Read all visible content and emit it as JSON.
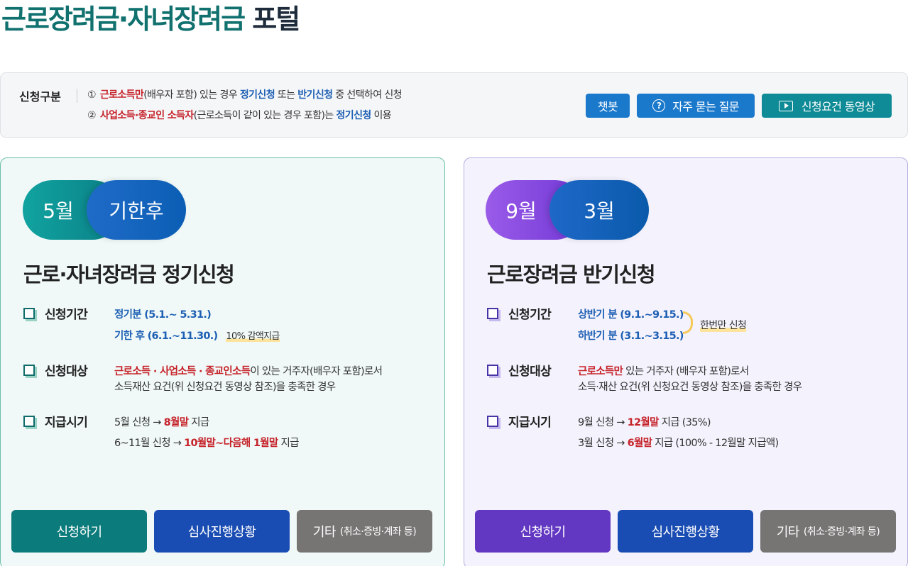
{
  "page": {
    "title_accent": "근로장려금·자녀장려금",
    "title_rest": "포털"
  },
  "info": {
    "label": "신청구분",
    "line1": {
      "num": "①",
      "highlight": "근로소득만",
      "t1": "(배우자 포함) 있는 경우 ",
      "blue1": "정기신청",
      "t2": " 또는 ",
      "blue2": "반기신청",
      "t3": " 중 선택하여 신청"
    },
    "line2": {
      "num": "②",
      "highlight": "사업소득·종교인 소득자",
      "t1": "(근로소득이 같이 있는 경우 포함)는 ",
      "blue1": "정기신청",
      "t2": " 이용"
    },
    "buttons": {
      "chatbot": "챗봇",
      "faq": "자주 묻는 질문",
      "video": "신청요건 동영상"
    }
  },
  "cards": {
    "regular": {
      "pill_a": "5월",
      "pill_b": "기한후",
      "title": "근로·자녀장려금 정기신청",
      "period_label": "신청기간",
      "period_1": "정기분 (5.1.~ 5.31.)",
      "period_2": "기한 후 (6.1.~11.30.)",
      "period_2_note": "10% 감액지급",
      "target_label": "신청대상",
      "target_red": "근로소득 · 사업소득 · 종교인소득",
      "target_t1": "이 있는 거주자(배우자 포함)로서",
      "target_t2": "소득재산 요건(위 신청요건 동영상 참조)을 충족한 경우",
      "pay_label": "지급시기",
      "pay_1_a": "5월 신청 → ",
      "pay_1_red": "8월말",
      "pay_1_b": " 지급",
      "pay_2_a": "6~11월 신청 → ",
      "pay_2_red": "10월말~다음해 1월말",
      "pay_2_b": " 지급",
      "btn_apply": "신청하기",
      "btn_status": "심사진행상황",
      "btn_etc": "기타",
      "btn_etc_small": "(취소·증빙·계좌 등)"
    },
    "semi": {
      "pill_a": "9월",
      "pill_b": "3월",
      "title": "근로장려금 반기신청",
      "period_label": "신청기간",
      "period_1": "상반기 분 (9.1.~9.15.)",
      "period_2": "하반기 분 (3.1.~3.15.)",
      "once_note": "한번만 신청",
      "target_label": "신청대상",
      "target_red": "근로소득만",
      "target_t1": " 있는 거주자 (배우자 포함)로서",
      "target_t2": "소득·재산 요건(위 신청요건 동영상 참조)을 충족한 경우",
      "pay_label": "지급시기",
      "pay_1_a": "9월 신청 → ",
      "pay_1_red": "12월말",
      "pay_1_b": " 지급 (35%)",
      "pay_2_a": "3월 신청 → ",
      "pay_2_red": "6월말",
      "pay_2_b": " 지급 (100% - 12월말 지급액)",
      "btn_apply": "신청하기",
      "btn_status": "심사진행상황",
      "btn_etc": "기타",
      "btn_etc_small": "(취소·증빙·계좌 등)"
    }
  },
  "colors": {
    "teal": "#0c7b7b",
    "purple": "#6237c2",
    "blue": "#1a4db3",
    "gray": "#777574",
    "highlight_red": "#c6232b",
    "highlight_blue": "#1d5fb4"
  }
}
